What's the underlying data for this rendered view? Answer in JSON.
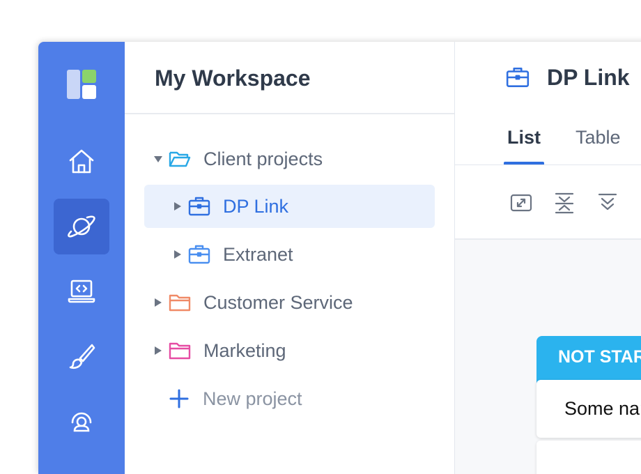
{
  "sidebar": {
    "items": [
      {
        "icon": "home-icon"
      },
      {
        "icon": "planet-icon",
        "active": true
      },
      {
        "icon": "laptop-code-icon"
      },
      {
        "icon": "paintbrush-icon"
      },
      {
        "icon": "support-headset-icon"
      }
    ]
  },
  "workspace": {
    "title": "My Workspace",
    "tree": [
      {
        "label": "Client projects",
        "icon": "folder-open-icon",
        "color": "#29a8e6",
        "expanded": true
      },
      {
        "label": "DP Link",
        "icon": "briefcase-icon",
        "color": "#2f6fe0",
        "selected": true
      },
      {
        "label": "Extranet",
        "icon": "briefcase-icon",
        "color": "#4a8ff0"
      },
      {
        "label": "Customer Service",
        "icon": "folder-icon",
        "color": "#f08a67"
      },
      {
        "label": "Marketing",
        "icon": "folder-icon",
        "color": "#e64ca3"
      }
    ],
    "new_project_label": "New project"
  },
  "main": {
    "title": "DP Link",
    "tabs": [
      {
        "label": "List",
        "active": true
      },
      {
        "label": "Table",
        "active": false
      }
    ],
    "toolbar": [
      "expand-icon",
      "collapse-icon",
      "chevrons-down-icon"
    ],
    "board": {
      "status_header": "NOT STARTED",
      "task_name": "Some name"
    }
  },
  "colors": {
    "rail": "#4f7ee8",
    "rail_active": "#3c66d1",
    "accent": "#2f6fe0",
    "status_not_started": "#2bb3ee"
  }
}
